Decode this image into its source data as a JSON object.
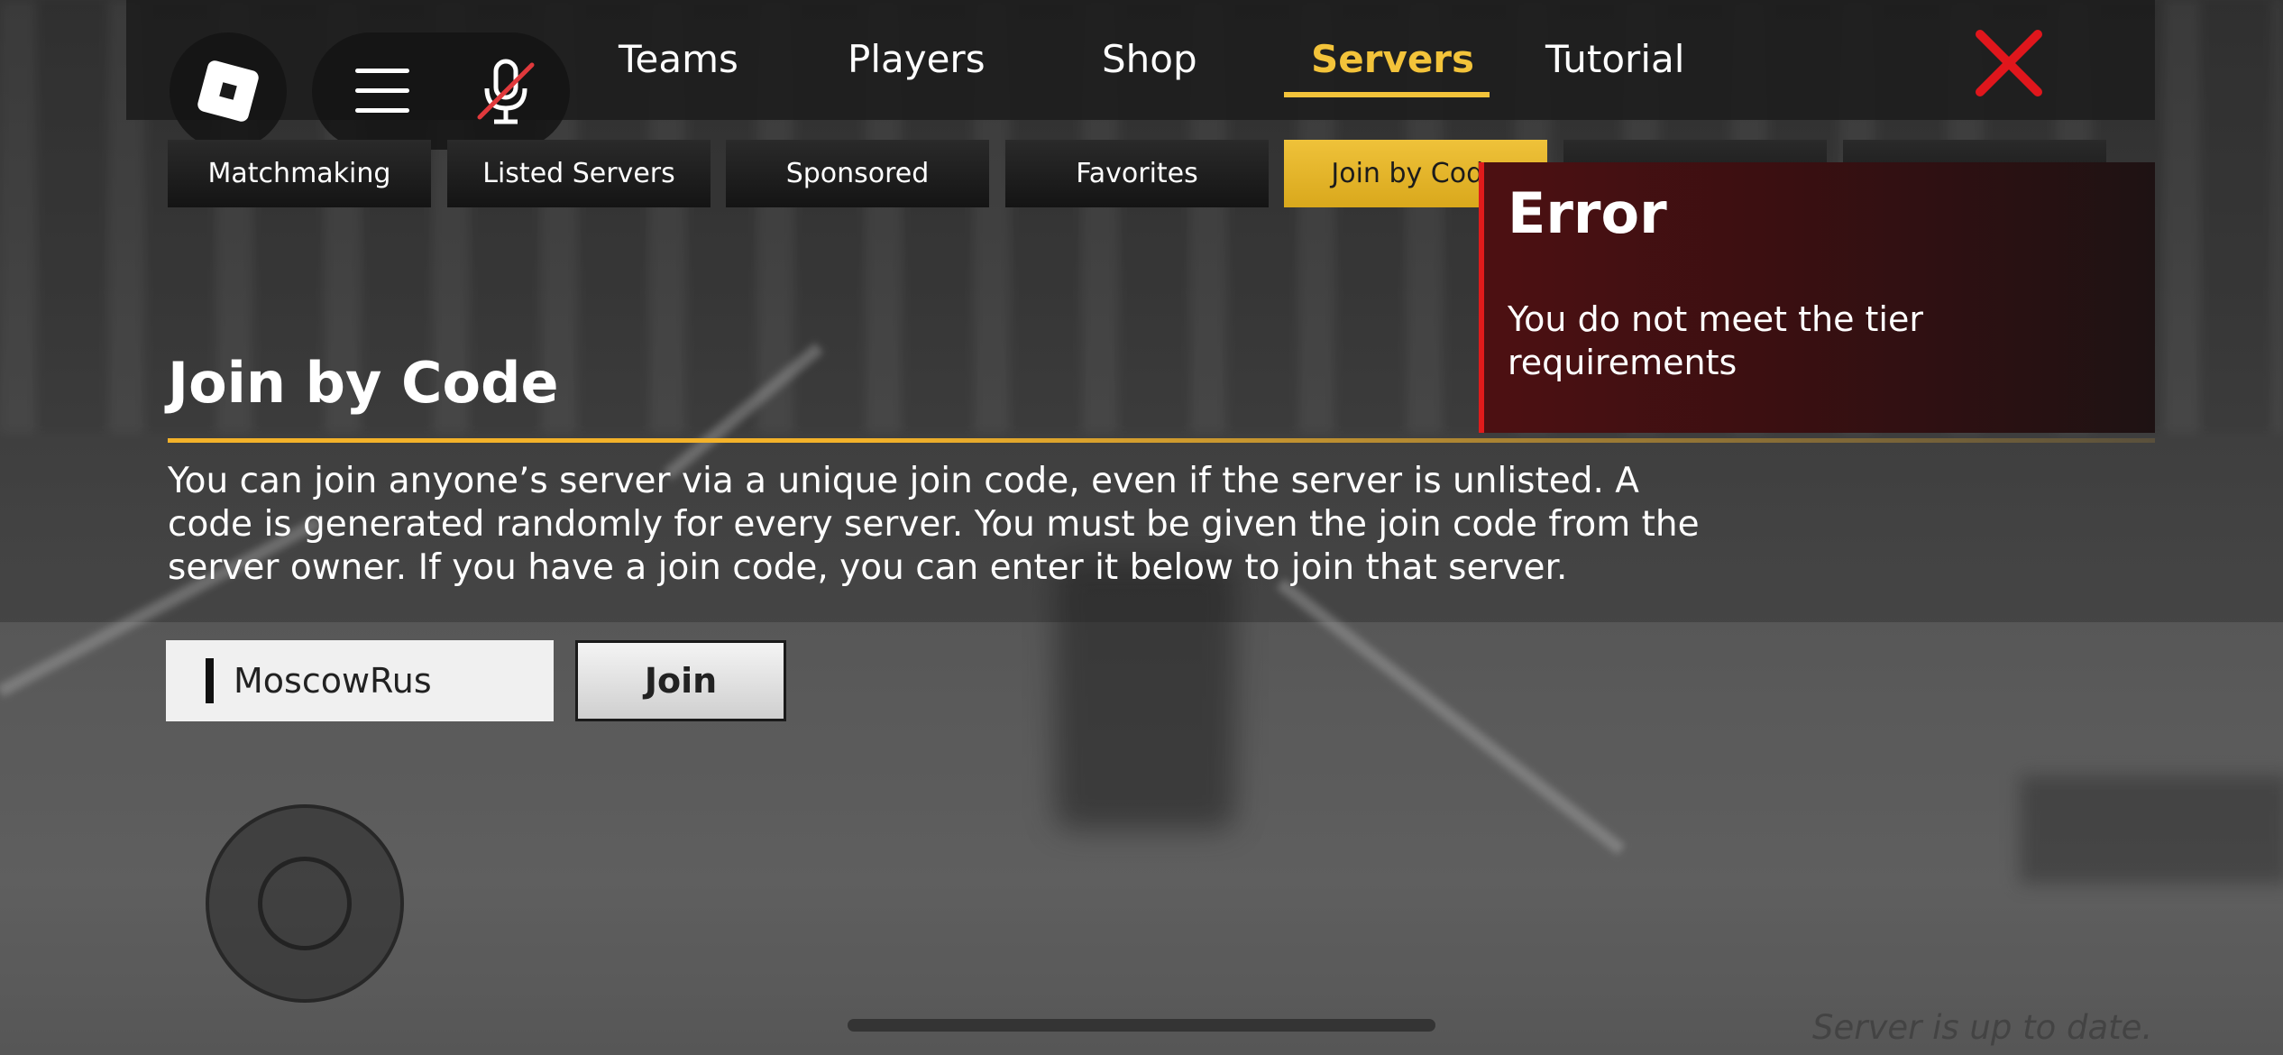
{
  "nav": {
    "tabs": [
      {
        "label": "Teams"
      },
      {
        "label": "Players"
      },
      {
        "label": "Shop"
      },
      {
        "label": "Servers",
        "active": true
      },
      {
        "label": "Tutorial"
      }
    ]
  },
  "subnav": {
    "tabs": [
      {
        "label": "Matchmaking"
      },
      {
        "label": "Listed Servers"
      },
      {
        "label": "Sponsored"
      },
      {
        "label": "Favorites"
      },
      {
        "label": "Join by Code",
        "active": true
      },
      {
        "label": ""
      },
      {
        "label": ""
      }
    ]
  },
  "main": {
    "title": "Join by Code",
    "description": "You can join anyone’s server via a unique join code, even if the server is unlisted. A code is generated randomly for every server. You must be given the join code from the server owner. If you have a join code, you can enter it below to join that server.",
    "code_value": "MoscowRus",
    "join_label": "Join"
  },
  "error": {
    "title": "Error",
    "message": "You do not meet the tier requirements"
  },
  "status": "Server is up to date.",
  "icons": {
    "logo": "roblox-logo-icon",
    "menu": "hamburger-menu-icon",
    "mic": "microphone-muted-icon",
    "close": "close-icon"
  },
  "colors": {
    "accent": "#f3c33a",
    "error_border": "#e01b1b",
    "close": "#e0161c"
  }
}
